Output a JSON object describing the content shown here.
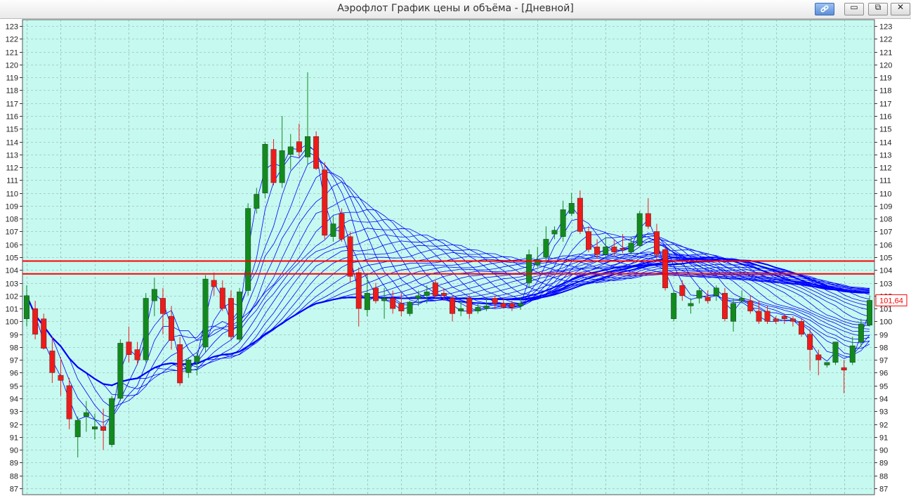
{
  "window": {
    "title": "Аэрофлот График цены и объёма - [Дневной]",
    "buttons": {
      "link_icon": "link-icon",
      "minimize_glyph": "▭",
      "restore_glyph": "⧉",
      "close_glyph": "✕"
    }
  },
  "colors": {
    "background": "#c6f9f0",
    "grid": "#8aa9a3",
    "bull": "#128a1e",
    "bear": "#ee1b1b",
    "ma": "#0000ff",
    "level": "#ff0000"
  },
  "chart_data": {
    "type": "candlestick",
    "title": "Аэрофлот График цены и объёма - [Дневной]",
    "ylim": [
      86.5,
      123.5
    ],
    "y_ticks": [
      87,
      88,
      89,
      90,
      91,
      92,
      93,
      94,
      95,
      96,
      97,
      98,
      99,
      100,
      101,
      102,
      103,
      104,
      105,
      106,
      107,
      108,
      109,
      110,
      111,
      112,
      113,
      114,
      115,
      116,
      117,
      118,
      119,
      120,
      121,
      122,
      123
    ],
    "last_price_label": "101,64",
    "last_price": 101.64,
    "horizontal_levels": [
      104.7,
      103.7
    ],
    "grid": true,
    "candles": [
      {
        "o": 100.2,
        "h": 102.8,
        "l": 99.6,
        "c": 102.0
      },
      {
        "o": 101.0,
        "h": 101.6,
        "l": 98.6,
        "c": 99.0
      },
      {
        "o": 100.2,
        "h": 100.6,
        "l": 97.8,
        "c": 97.9
      },
      {
        "o": 97.7,
        "h": 98.8,
        "l": 95.2,
        "c": 96.0
      },
      {
        "o": 95.8,
        "h": 97.2,
        "l": 94.2,
        "c": 95.4
      },
      {
        "o": 95.0,
        "h": 95.6,
        "l": 91.6,
        "c": 92.4
      },
      {
        "o": 91.0,
        "h": 92.6,
        "l": 89.4,
        "c": 92.3
      },
      {
        "o": 92.6,
        "h": 93.8,
        "l": 91.4,
        "c": 92.9
      },
      {
        "o": 91.6,
        "h": 92.8,
        "l": 90.8,
        "c": 91.8
      },
      {
        "o": 91.8,
        "h": 93.2,
        "l": 90.0,
        "c": 91.5
      },
      {
        "o": 90.4,
        "h": 94.2,
        "l": 90.2,
        "c": 94.0
      },
      {
        "o": 94.0,
        "h": 98.6,
        "l": 93.8,
        "c": 98.3
      },
      {
        "o": 98.4,
        "h": 99.6,
        "l": 96.8,
        "c": 97.4
      },
      {
        "o": 97.8,
        "h": 98.4,
        "l": 96.6,
        "c": 97.0
      },
      {
        "o": 97.0,
        "h": 102.2,
        "l": 96.8,
        "c": 101.8
      },
      {
        "o": 101.6,
        "h": 103.4,
        "l": 100.4,
        "c": 102.5
      },
      {
        "o": 101.8,
        "h": 102.6,
        "l": 99.0,
        "c": 100.6
      },
      {
        "o": 100.4,
        "h": 101.2,
        "l": 97.8,
        "c": 98.5
      },
      {
        "o": 98.2,
        "h": 98.8,
        "l": 95.0,
        "c": 95.2
      },
      {
        "o": 96.0,
        "h": 97.2,
        "l": 95.6,
        "c": 97.0
      },
      {
        "o": 96.8,
        "h": 97.6,
        "l": 95.8,
        "c": 97.3
      },
      {
        "o": 98.0,
        "h": 103.6,
        "l": 97.6,
        "c": 103.3
      },
      {
        "o": 103.2,
        "h": 103.8,
        "l": 102.0,
        "c": 102.7
      },
      {
        "o": 102.6,
        "h": 103.2,
        "l": 100.8,
        "c": 101.0
      },
      {
        "o": 101.8,
        "h": 102.4,
        "l": 98.6,
        "c": 98.8
      },
      {
        "o": 98.6,
        "h": 102.6,
        "l": 98.4,
        "c": 102.3
      },
      {
        "o": 102.4,
        "h": 109.2,
        "l": 102.0,
        "c": 108.8
      },
      {
        "o": 108.8,
        "h": 110.4,
        "l": 108.4,
        "c": 109.9
      },
      {
        "o": 110.0,
        "h": 114.0,
        "l": 109.6,
        "c": 113.8
      },
      {
        "o": 113.4,
        "h": 114.2,
        "l": 110.6,
        "c": 110.8
      },
      {
        "o": 110.8,
        "h": 116.0,
        "l": 110.4,
        "c": 113.3
      },
      {
        "o": 113.0,
        "h": 114.6,
        "l": 111.8,
        "c": 113.6
      },
      {
        "o": 114.0,
        "h": 115.4,
        "l": 112.8,
        "c": 113.2
      },
      {
        "o": 112.8,
        "h": 119.4,
        "l": 112.2,
        "c": 114.4
      },
      {
        "o": 114.4,
        "h": 114.8,
        "l": 111.8,
        "c": 111.9
      },
      {
        "o": 111.8,
        "h": 112.4,
        "l": 106.4,
        "c": 106.7
      },
      {
        "o": 106.6,
        "h": 108.2,
        "l": 106.2,
        "c": 107.6
      },
      {
        "o": 108.4,
        "h": 108.8,
        "l": 106.2,
        "c": 106.4
      },
      {
        "o": 106.6,
        "h": 107.0,
        "l": 103.0,
        "c": 103.5
      },
      {
        "o": 103.8,
        "h": 104.2,
        "l": 99.6,
        "c": 101.0
      },
      {
        "o": 100.9,
        "h": 103.6,
        "l": 100.4,
        "c": 102.2
      },
      {
        "o": 102.6,
        "h": 103.0,
        "l": 101.4,
        "c": 101.6
      },
      {
        "o": 101.6,
        "h": 102.6,
        "l": 100.2,
        "c": 101.8
      },
      {
        "o": 101.8,
        "h": 102.4,
        "l": 100.6,
        "c": 101.0
      },
      {
        "o": 101.4,
        "h": 102.2,
        "l": 100.4,
        "c": 100.8
      },
      {
        "o": 100.6,
        "h": 101.6,
        "l": 100.4,
        "c": 101.5
      },
      {
        "o": 101.8,
        "h": 102.4,
        "l": 101.2,
        "c": 102.0
      },
      {
        "o": 102.0,
        "h": 102.8,
        "l": 101.4,
        "c": 102.3
      },
      {
        "o": 103.0,
        "h": 103.2,
        "l": 101.8,
        "c": 102.0
      },
      {
        "o": 102.2,
        "h": 102.6,
        "l": 101.6,
        "c": 102.0
      },
      {
        "o": 101.8,
        "h": 102.0,
        "l": 100.0,
        "c": 100.6
      },
      {
        "o": 100.8,
        "h": 101.6,
        "l": 100.4,
        "c": 101.0
      },
      {
        "o": 101.8,
        "h": 102.0,
        "l": 100.2,
        "c": 100.6
      },
      {
        "o": 100.8,
        "h": 101.4,
        "l": 100.6,
        "c": 101.1
      },
      {
        "o": 101.0,
        "h": 101.8,
        "l": 100.8,
        "c": 101.2
      },
      {
        "o": 101.8,
        "h": 102.0,
        "l": 101.0,
        "c": 101.4
      },
      {
        "o": 101.4,
        "h": 101.8,
        "l": 101.0,
        "c": 101.1
      },
      {
        "o": 101.4,
        "h": 101.6,
        "l": 100.8,
        "c": 101.1
      },
      {
        "o": 101.2,
        "h": 101.8,
        "l": 100.9,
        "c": 101.4
      },
      {
        "o": 103.0,
        "h": 105.6,
        "l": 102.6,
        "c": 105.2
      },
      {
        "o": 104.4,
        "h": 105.8,
        "l": 104.2,
        "c": 104.8
      },
      {
        "o": 105.0,
        "h": 107.4,
        "l": 104.6,
        "c": 106.4
      },
      {
        "o": 106.8,
        "h": 107.4,
        "l": 106.4,
        "c": 107.1
      },
      {
        "o": 106.6,
        "h": 109.4,
        "l": 106.2,
        "c": 108.7
      },
      {
        "o": 108.4,
        "h": 110.0,
        "l": 108.2,
        "c": 109.2
      },
      {
        "o": 109.6,
        "h": 110.2,
        "l": 106.8,
        "c": 107.0
      },
      {
        "o": 107.0,
        "h": 107.4,
        "l": 105.4,
        "c": 105.6
      },
      {
        "o": 105.8,
        "h": 106.4,
        "l": 104.9,
        "c": 105.2
      },
      {
        "o": 105.2,
        "h": 106.6,
        "l": 105.0,
        "c": 105.8
      },
      {
        "o": 105.8,
        "h": 106.4,
        "l": 105.1,
        "c": 105.4
      },
      {
        "o": 105.7,
        "h": 106.8,
        "l": 105.3,
        "c": 105.6
      },
      {
        "o": 105.4,
        "h": 106.6,
        "l": 105.2,
        "c": 106.1
      },
      {
        "o": 105.9,
        "h": 108.6,
        "l": 105.8,
        "c": 108.4
      },
      {
        "o": 108.4,
        "h": 109.6,
        "l": 107.2,
        "c": 107.4
      },
      {
        "o": 107.0,
        "h": 107.6,
        "l": 104.8,
        "c": 105.2
      },
      {
        "o": 105.6,
        "h": 105.8,
        "l": 102.4,
        "c": 102.6
      },
      {
        "o": 100.2,
        "h": 102.4,
        "l": 100.0,
        "c": 102.2
      },
      {
        "o": 102.8,
        "h": 103.2,
        "l": 101.6,
        "c": 102.0
      },
      {
        "o": 101.2,
        "h": 101.8,
        "l": 100.6,
        "c": 101.4
      },
      {
        "o": 101.8,
        "h": 102.6,
        "l": 101.4,
        "c": 102.4
      },
      {
        "o": 101.9,
        "h": 102.4,
        "l": 101.4,
        "c": 101.6
      },
      {
        "o": 102.0,
        "h": 102.8,
        "l": 101.6,
        "c": 102.6
      },
      {
        "o": 102.2,
        "h": 102.6,
        "l": 100.0,
        "c": 100.2
      },
      {
        "o": 100.0,
        "h": 101.8,
        "l": 99.2,
        "c": 101.4
      },
      {
        "o": 101.6,
        "h": 102.4,
        "l": 101.4,
        "c": 101.8
      },
      {
        "o": 101.6,
        "h": 102.0,
        "l": 100.6,
        "c": 100.8
      },
      {
        "o": 100.8,
        "h": 101.6,
        "l": 99.8,
        "c": 100.0
      },
      {
        "o": 100.8,
        "h": 101.2,
        "l": 99.8,
        "c": 100.0
      },
      {
        "o": 100.2,
        "h": 100.4,
        "l": 99.8,
        "c": 100.0
      },
      {
        "o": 100.4,
        "h": 100.6,
        "l": 99.8,
        "c": 100.2
      },
      {
        "o": 100.2,
        "h": 100.4,
        "l": 99.6,
        "c": 100.0
      },
      {
        "o": 100.0,
        "h": 100.2,
        "l": 98.8,
        "c": 99.0
      },
      {
        "o": 99.0,
        "h": 99.4,
        "l": 96.2,
        "c": 97.8
      },
      {
        "o": 97.4,
        "h": 97.8,
        "l": 95.8,
        "c": 97.0
      },
      {
        "o": 96.6,
        "h": 96.8,
        "l": 96.4,
        "c": 96.8
      },
      {
        "o": 96.8,
        "h": 98.4,
        "l": 96.6,
        "c": 98.4
      },
      {
        "o": 96.4,
        "h": 97.0,
        "l": 94.4,
        "c": 96.2
      },
      {
        "o": 96.8,
        "h": 98.8,
        "l": 96.6,
        "c": 98.1
      },
      {
        "o": 98.4,
        "h": 100.2,
        "l": 98.0,
        "c": 99.8
      },
      {
        "o": 99.7,
        "h": 102.0,
        "l": 99.6,
        "c": 101.64
      }
    ]
  }
}
